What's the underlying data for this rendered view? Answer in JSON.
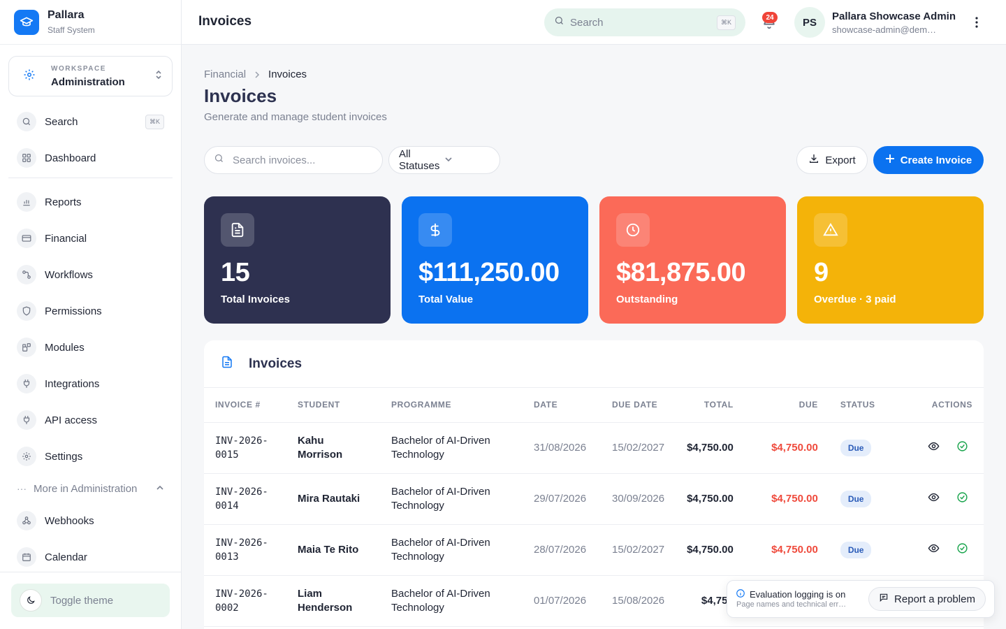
{
  "brand": {
    "name": "Pallara",
    "subtitle": "Staff System"
  },
  "workspace": {
    "label": "WORKSPACE",
    "name": "Administration"
  },
  "sidebar": {
    "search_label": "Search",
    "search_shortcut": "⌘K",
    "items_top": [
      {
        "label": "Dashboard",
        "icon": "dashboard-icon"
      }
    ],
    "items": [
      {
        "label": "Reports",
        "icon": "bar-chart-icon"
      },
      {
        "label": "Financial",
        "icon": "credit-card-icon"
      },
      {
        "label": "Workflows",
        "icon": "workflow-icon"
      },
      {
        "label": "Permissions",
        "icon": "shield-icon"
      },
      {
        "label": "Modules",
        "icon": "modules-icon"
      },
      {
        "label": "Integrations",
        "icon": "plug-icon"
      },
      {
        "label": "API access",
        "icon": "plug-icon"
      },
      {
        "label": "Settings",
        "icon": "gear-icon"
      }
    ],
    "more_label": "More in Administration",
    "more_items": [
      {
        "label": "Webhooks",
        "icon": "webhook-icon"
      },
      {
        "label": "Calendar",
        "icon": "calendar-icon"
      }
    ],
    "toggle_theme": "Toggle theme"
  },
  "topbar": {
    "title": "Invoices",
    "search_placeholder": "Search",
    "search_shortcut": "⌘K",
    "notification_count": "24",
    "avatar_initials": "PS",
    "user_name": "Pallara Showcase Admin",
    "user_email": "showcase-admin@dem…"
  },
  "breadcrumb": {
    "root": "Financial",
    "current": "Invoices"
  },
  "page": {
    "title": "Invoices",
    "subtitle": "Generate and manage student invoices"
  },
  "filters": {
    "search_placeholder": "Search invoices...",
    "status_value": "All Statuses",
    "export_label": "Export",
    "create_label": "Create Invoice"
  },
  "stats": [
    {
      "value": "15",
      "label": "Total Invoices",
      "color": "#2e3150",
      "icon": "document-icon"
    },
    {
      "value": "$111,250.00",
      "label": "Total Value",
      "color": "#0b72f0",
      "icon": "dollar-icon"
    },
    {
      "value": "$81,875.00",
      "label": "Outstanding",
      "color": "#fb6a58",
      "icon": "clock-icon"
    },
    {
      "value": "9",
      "label": "Overdue · 3 paid",
      "color": "#f4b309",
      "icon": "warning-icon"
    }
  ],
  "table": {
    "title": "Invoices",
    "columns": [
      "INVOICE #",
      "STUDENT",
      "PROGRAMME",
      "DATE",
      "DUE DATE",
      "TOTAL",
      "DUE",
      "STATUS",
      "ACTIONS"
    ],
    "rows": [
      {
        "invoice": "INV-2026-0015",
        "student": "Kahu Morrison",
        "programme": "Bachelor of AI-Driven Technology",
        "date": "31/08/2026",
        "due_date": "15/02/2027",
        "total": "$4,750.00",
        "due": "$4,750.00",
        "status": "Due"
      },
      {
        "invoice": "INV-2026-0014",
        "student": "Mira Rautaki",
        "programme": "Bachelor of AI-Driven Technology",
        "date": "29/07/2026",
        "due_date": "30/09/2026",
        "total": "$4,750.00",
        "due": "$4,750.00",
        "status": "Due"
      },
      {
        "invoice": "INV-2026-0013",
        "student": "Maia Te Rito",
        "programme": "Bachelor of AI-Driven Technology",
        "date": "28/07/2026",
        "due_date": "15/02/2027",
        "total": "$4,750.00",
        "due": "$4,750.00",
        "status": "Due"
      },
      {
        "invoice": "INV-2026-0002",
        "student": "Liam Henderson",
        "programme": "Bachelor of AI-Driven Technology",
        "date": "01/07/2026",
        "due_date": "15/08/2026",
        "total": "$4,750",
        "due": "",
        "status": ""
      }
    ]
  },
  "toast": {
    "title": "Evaluation logging is on",
    "description": "Page names and technical err…",
    "report_label": "Report a problem"
  }
}
